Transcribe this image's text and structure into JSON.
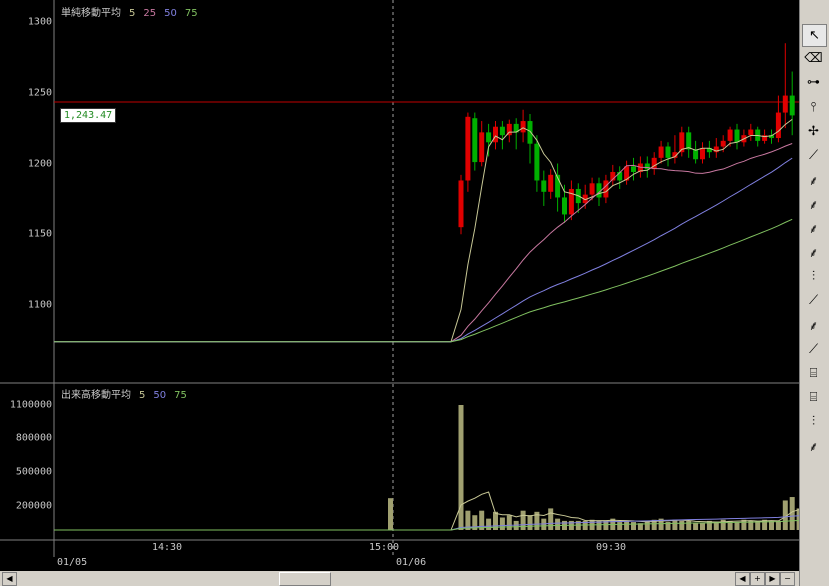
{
  "price_panel": {
    "title": "単純移動平均",
    "ma_periods": [
      "5",
      "25",
      "50",
      "75"
    ],
    "ma_colors": [
      "#c8c896",
      "#c878a0",
      "#8080e0",
      "#80c060"
    ],
    "y_ticks": [
      "1300",
      "1250",
      "1200",
      "1150",
      "1100"
    ],
    "current_price_label": "1,243.47",
    "current_price": 1243.47
  },
  "volume_panel": {
    "title": "出来高移動平均",
    "ma_periods": [
      "5",
      "50",
      "75"
    ],
    "ma_colors": [
      "#c8c896",
      "#8080e0",
      "#80c060"
    ],
    "y_ticks": [
      "1100000",
      "800000",
      "500000",
      "200000"
    ]
  },
  "time_axis": {
    "times": [
      "14:30",
      "15:00",
      "09:30"
    ],
    "dates": [
      "01/05",
      "01/06"
    ]
  },
  "colors": {
    "up": "#e00000",
    "down": "#00b000",
    "volume": "#a0a070",
    "hline": "#c00000",
    "crosshair": "#a0a0a0"
  },
  "toolbar": {
    "tools": [
      "cursor-icon",
      "eraser-icon",
      "horizontal-line-icon",
      "vertical-line-icon",
      "crosshair-icon",
      "trendline-icon",
      "fibonacci-fan-icon",
      "fibonacci-icon",
      "speed-lines-icon",
      "gann-fan-icon",
      "parallel-lines-icon",
      "line-tool-icon",
      "gann-icon",
      "channel-icon",
      "parallel-channel-icon",
      "fibonacci-retracement-icon",
      "cycle-lines-icon",
      "pitchfork-icon"
    ]
  },
  "chart_data": {
    "type": "candlestick",
    "price_ylim": [
      1050,
      1310
    ],
    "volume_ylim": [
      0,
      1250000
    ],
    "prior_close": 1074,
    "candles": [
      [
        1155,
        1188,
        1150,
        1192
      ],
      [
        1188,
        1233,
        1180,
        1236
      ],
      [
        1232,
        1201,
        1195,
        1236
      ],
      [
        1201,
        1222,
        1198,
        1230
      ],
      [
        1222,
        1215,
        1205,
        1228
      ],
      [
        1215,
        1226,
        1210,
        1230
      ],
      [
        1226,
        1220,
        1210,
        1230
      ],
      [
        1220,
        1228,
        1215,
        1231
      ],
      [
        1228,
        1222,
        1210,
        1232
      ],
      [
        1222,
        1230,
        1215,
        1238
      ],
      [
        1230,
        1214,
        1200,
        1235
      ],
      [
        1214,
        1188,
        1180,
        1220
      ],
      [
        1188,
        1180,
        1170,
        1195
      ],
      [
        1180,
        1192,
        1175,
        1196
      ],
      [
        1192,
        1176,
        1166,
        1200
      ],
      [
        1176,
        1164,
        1158,
        1185
      ],
      [
        1164,
        1182,
        1160,
        1188
      ],
      [
        1182,
        1172,
        1165,
        1186
      ],
      [
        1172,
        1178,
        1168,
        1185
      ],
      [
        1178,
        1186,
        1174,
        1190
      ],
      [
        1186,
        1176,
        1170,
        1190
      ],
      [
        1176,
        1188,
        1172,
        1192
      ],
      [
        1188,
        1194,
        1184,
        1199
      ],
      [
        1194,
        1188,
        1182,
        1198
      ],
      [
        1188,
        1198,
        1185,
        1202
      ],
      [
        1198,
        1194,
        1188,
        1204
      ],
      [
        1194,
        1200,
        1190,
        1205
      ],
      [
        1200,
        1196,
        1190,
        1205
      ],
      [
        1196,
        1204,
        1192,
        1208
      ],
      [
        1204,
        1212,
        1200,
        1216
      ],
      [
        1212,
        1204,
        1198,
        1215
      ],
      [
        1204,
        1208,
        1200,
        1220
      ],
      [
        1208,
        1222,
        1205,
        1226
      ],
      [
        1222,
        1210,
        1204,
        1226
      ],
      [
        1210,
        1203,
        1200,
        1216
      ],
      [
        1203,
        1211,
        1200,
        1215
      ],
      [
        1211,
        1208,
        1204,
        1216
      ],
      [
        1208,
        1212,
        1204,
        1218
      ],
      [
        1212,
        1216,
        1208,
        1220
      ],
      [
        1216,
        1224,
        1212,
        1226
      ],
      [
        1224,
        1215,
        1210,
        1228
      ],
      [
        1215,
        1220,
        1212,
        1224
      ],
      [
        1220,
        1224,
        1216,
        1228
      ],
      [
        1224,
        1216,
        1212,
        1226
      ],
      [
        1216,
        1220,
        1214,
        1224
      ],
      [
        1220,
        1218,
        1214,
        1224
      ],
      [
        1218,
        1236,
        1215,
        1248
      ],
      [
        1236,
        1248,
        1225,
        1285
      ],
      [
        1248,
        1234,
        1220,
        1265
      ]
    ],
    "volumes": [
      1100000,
      170000,
      130000,
      170000,
      100000,
      160000,
      110000,
      130000,
      80000,
      170000,
      130000,
      160000,
      100000,
      190000,
      100000,
      80000,
      80000,
      80000,
      80000,
      90000,
      80000,
      80000,
      100000,
      70000,
      80000,
      70000,
      60000,
      80000,
      90000,
      100000,
      70000,
      90000,
      80000,
      80000,
      60000,
      60000,
      80000,
      70000,
      90000,
      80000,
      70000,
      90000,
      80000,
      70000,
      90000,
      80000,
      80000,
      260000,
      290000,
      190000
    ],
    "prior_session_volume": 280000
  }
}
